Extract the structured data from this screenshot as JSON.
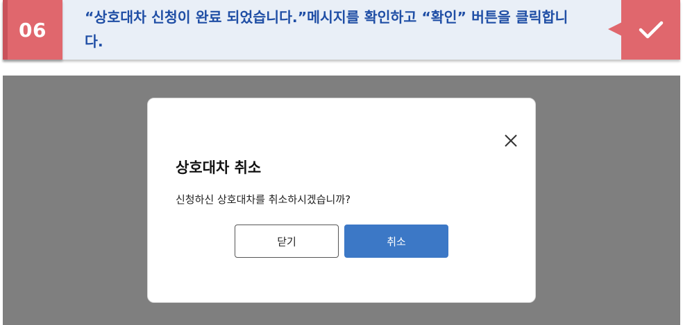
{
  "banner": {
    "step_number": "06",
    "instruction": "“상호대차 신청이 완료 되었습니다.”메시지를 확인하고 “확인” 버튼을 클릭합니다.",
    "check_icon": "check-icon",
    "accent_color": "#e0676d",
    "text_color": "#1f4ea5"
  },
  "dialog": {
    "title": "상호대차 취소",
    "message": "신청하신 상호대차를 취소하시겠습니까?",
    "close_icon": "close-icon",
    "close_button_label": "닫기",
    "confirm_button_label": "취소",
    "confirm_color": "#3c78c6"
  },
  "overlay_color": "#7f7f7f"
}
